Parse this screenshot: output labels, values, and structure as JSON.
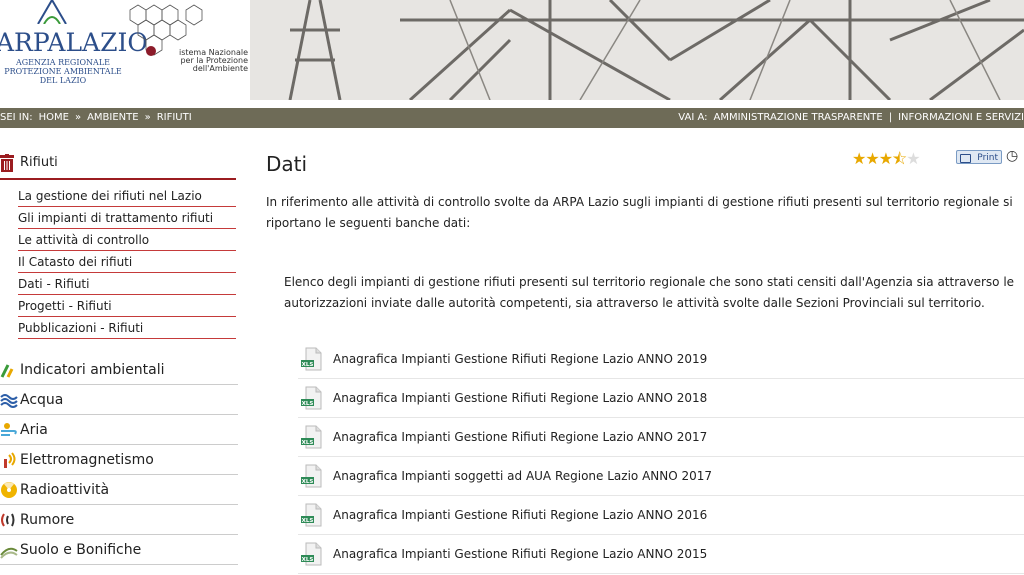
{
  "header": {
    "logo_title": "ARPALAZIO",
    "logo_sub": [
      "AGENZIA REGIONALE",
      "PROTEZIONE AMBIENTALE",
      "DEL LAZIO"
    ],
    "snpa_text": [
      "istema Nazionale",
      "per la Protezione",
      "dell'Ambiente"
    ]
  },
  "breadcrumb": {
    "prefix": "SEI IN:",
    "items": [
      "HOME",
      "»",
      "AMBIENTE",
      "»",
      "RIFIUTI"
    ]
  },
  "vai": {
    "prefix": "VAI A:",
    "links": [
      "AMMINISTRAZIONE TRASPARENTE",
      "|",
      "INFORMAZIONI E SERVIZI"
    ]
  },
  "sidebar": {
    "section_title": "Rifiuti",
    "sub_items": [
      "La gestione dei rifiuti nel Lazio",
      "Gli impianti di trattamento rifiuti",
      "Le attività di controllo",
      "Il Catasto dei rifiuti",
      "Dati - Rifiuti",
      "Progetti - Rifiuti",
      "Pubblicazioni - Rifiuti"
    ],
    "categories": [
      {
        "label": "Indicatori ambientali",
        "icon": "indicators-icon",
        "color": "#3a9a3a"
      },
      {
        "label": "Acqua",
        "icon": "water-icon",
        "color": "#2c5ea8"
      },
      {
        "label": "Aria",
        "icon": "air-icon",
        "color": "#4aa8d8"
      },
      {
        "label": "Elettromagnetismo",
        "icon": "electromagnetism-icon",
        "color": "#e8a800"
      },
      {
        "label": "Radioattività",
        "icon": "radioactivity-icon",
        "color": "#f0b400"
      },
      {
        "label": "Rumore",
        "icon": "noise-icon",
        "color": "#c0392b"
      },
      {
        "label": "Suolo e Bonifiche",
        "icon": "soil-icon",
        "color": "#6a8a3a"
      }
    ]
  },
  "main": {
    "title": "Dati",
    "rating": {
      "value": 3.5,
      "max": 5
    },
    "print_label": "Print",
    "intro": "In riferimento alle attività di controllo svolte da ARPA Lazio sugli impianti di gestione rifiuti presenti sul territorio regionale si riportano le seguenti banche dati:",
    "description": "Elenco degli impianti di gestione rifiuti presenti sul territorio regionale che sono stati censiti dall'Agenzia sia attraverso le autorizzazioni inviate dalle autorità competenti, sia attraverso le attività svolte dalle Sezioni Provinciali sul territorio.",
    "files": [
      "Anagrafica Impianti Gestione Rifiuti Regione Lazio ANNO 2019",
      "Anagrafica Impianti Gestione Rifiuti Regione Lazio ANNO 2018",
      "Anagrafica Impianti Gestione Rifiuti Regione Lazio ANNO 2017",
      "Anagrafica Impianti soggetti ad AUA Regione Lazio ANNO 2017",
      "Anagrafica Impianti Gestione Rifiuti Regione Lazio ANNO 2016",
      "Anagrafica Impianti Gestione Rifiuti Regione Lazio ANNO 2015"
    ],
    "file_type": "XLS"
  },
  "colors": {
    "accent": "#9b1c20",
    "navbar": "#6e6b57",
    "logo": "#2c4e8a",
    "star": "#e8a800"
  }
}
